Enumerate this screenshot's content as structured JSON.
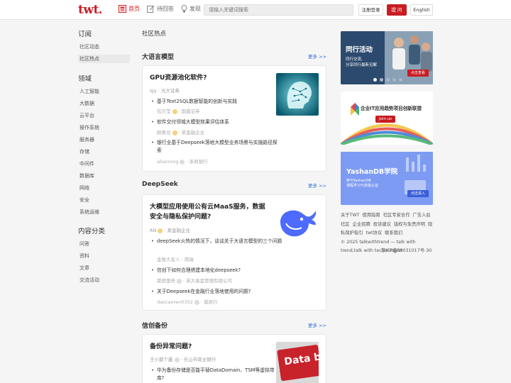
{
  "header": {
    "logo": "twt",
    "nav": [
      {
        "label": "首页"
      },
      {
        "label": "待回答"
      },
      {
        "label": "发现"
      }
    ],
    "search_placeholder": "请输入关键词搜索",
    "login_label": "注册登录",
    "ask_label": "提 问",
    "lang_label": "English",
    "accent": "#c81c23"
  },
  "sidebar": {
    "sections": [
      {
        "title": "订阅",
        "items": [
          "社区动态",
          "社区热点"
        ]
      },
      {
        "title": "领域",
        "items": [
          "人工智能",
          "大数据",
          "云平台",
          "操作系统",
          "服务器",
          "存储",
          "中间件",
          "数据库",
          "网络",
          "安全",
          "系统运维"
        ]
      },
      {
        "title": "内容分类",
        "items": [
          "问答",
          "资料",
          "文章",
          "交流活动"
        ]
      }
    ],
    "active_item": "社区热点"
  },
  "main": {
    "page_title": "社区热点",
    "more_label": "更多 >>",
    "sections": [
      {
        "title": "大语言模型",
        "card": {
          "title": "GPU资源池化软件?",
          "meta": "lgy · 光大证券",
          "questions": [
            {
              "text": "基于Text2SQL数据智能的创新与实践",
              "meta_user": "包万莹",
              "meta_org": "国盛证券"
            },
            {
              "text": "软件交付领域大模型效果评估体系",
              "meta_user": "顾黄兑",
              "meta_org": "某金融企业"
            },
            {
              "text": "银行业基于Deepseek落地大模型业务场景与实施路径探索",
              "meta_user": "allanrong",
              "meta_org": "浙商银行"
            }
          ]
        }
      },
      {
        "title": "DeepSeek",
        "card": {
          "title": "大模型应用使用公有云MaaS服务，数据安全与隐私保护问题?",
          "meta_user": "AN",
          "meta_org": "某金融企业",
          "questions": [
            {
              "text": "deepSeek火热的情况下，谈谈关于大语言模型的三个问题",
              "meta_user": "金陵大盲人",
              "meta_org": "南瑞"
            },
            {
              "text": "信创下如何合理搭建本地化deepseek?",
              "meta_user": "莫德里奇",
              "meta_org": "英大基金管理有限公司"
            },
            {
              "text": "关于Deepseek在金融行业落地使用的问题?",
              "meta_user": "daocaoren0352",
              "meta_org": "城商行"
            }
          ]
        }
      },
      {
        "title": "信创备份",
        "card": {
          "title": "备份异常问题?",
          "meta_user": "王小那个鑫",
          "meta_org": "乐山市商业银行",
          "thumb_text": "Data backup",
          "questions": [
            {
              "text": "华为备份存储是否能平替DataDomain、TSM等虚拟带库?"
            }
          ]
        }
      }
    ]
  },
  "right": {
    "banner1": {
      "title": "同行活动",
      "line1": "同行交流,",
      "line2": "分享同行最新见解",
      "button": "点击查看"
    },
    "banner2": {
      "title": "企业IT应用趋势项目创新联盟",
      "button": "Join us"
    },
    "banner3": {
      "title": "YashanDB学院",
      "line1": "参与YashanDB",
      "line2": "课程学习与技能认证",
      "button": "点击进入"
    },
    "footer": {
      "links": [
        "关于TWT",
        "使用指南",
        "社区专家合作",
        "广告入驻社区",
        "企业招聘",
        "投诉建议",
        "版权与免责声明",
        "隐私保护指引",
        "twt协议",
        "联系我们"
      ],
      "copyright": "© 2025 talkwithtrend — talk with trend,talk with technologist",
      "icp": "京ICP备09031017号-30"
    }
  }
}
